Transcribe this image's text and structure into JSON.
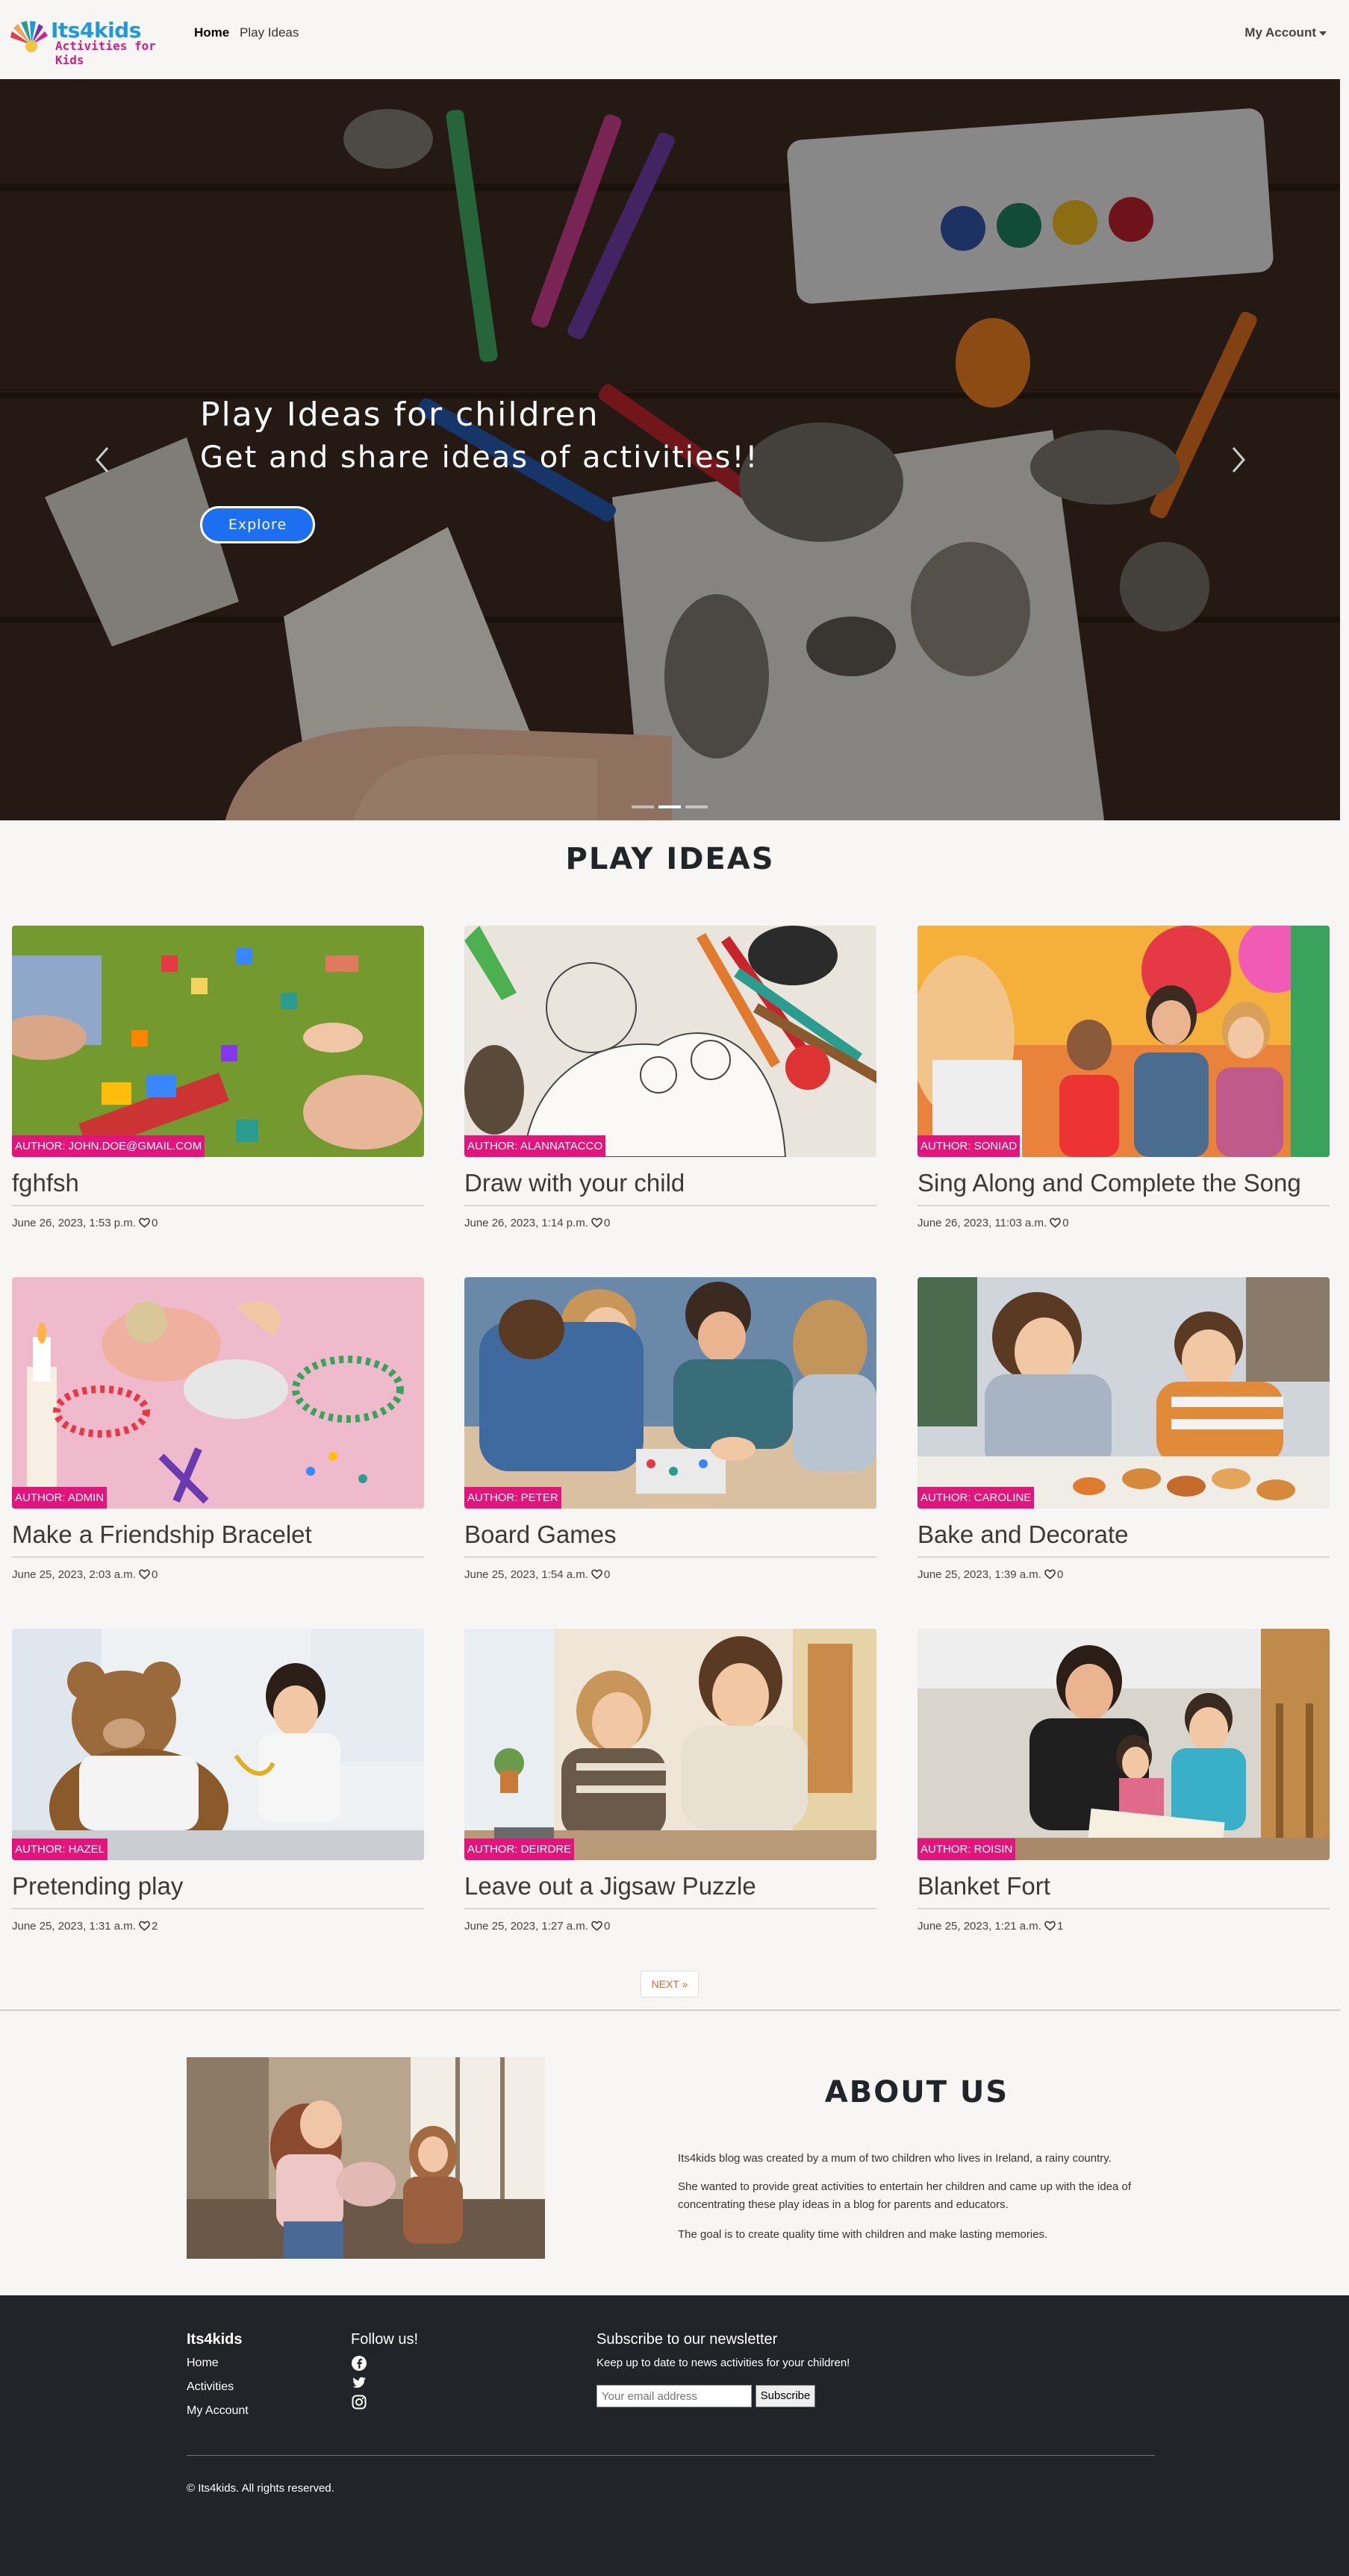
{
  "brand": {
    "name": "Its4kids",
    "tagline": "Activities for Kids"
  },
  "nav": {
    "home": "Home",
    "play_ideas": "Play Ideas",
    "account": "My Account"
  },
  "hero": {
    "caption_line1": "Play Ideas for children",
    "caption_line2": "Get and share ideas of activities!!",
    "button": "Explore",
    "slides": 3,
    "active_slide": 2
  },
  "play_ideas": {
    "heading": "PLAY IDEAS",
    "cards": [
      {
        "author": "AUTHOR: JOHN.DOE@GMAIL.COM",
        "title": "fghfsh",
        "date": "June 26, 2023, 1:53 p.m.",
        "likes": "0",
        "image": "toy-blocks-on-grass"
      },
      {
        "author": "AUTHOR: ALANNATACCO",
        "title": "Draw with your child",
        "date": "June 26, 2023, 1:14 p.m.",
        "likes": "0",
        "image": "coloring-page-pencils"
      },
      {
        "author": "AUTHOR: SONIAD",
        "title": "Sing Along and Complete the Song",
        "date": "June 26, 2023, 11:03 a.m.",
        "likes": "0",
        "image": "children-sitting"
      },
      {
        "author": "AUTHOR: ADMIN",
        "title": "Make a Friendship Bracelet",
        "date": "June 25, 2023, 2:03 a.m.",
        "likes": "0",
        "image": "beads-bracelets"
      },
      {
        "author": "AUTHOR: PETER",
        "title": "Board Games",
        "date": "June 25, 2023, 1:54 a.m.",
        "likes": "0",
        "image": "family-board-game"
      },
      {
        "author": "AUTHOR: CAROLINE",
        "title": "Bake and Decorate",
        "date": "June 25, 2023, 1:39 a.m.",
        "likes": "0",
        "image": "kids-decorating-cookies"
      },
      {
        "author": "AUTHOR: HAZEL",
        "title": "Pretending play",
        "date": "June 25, 2023, 1:31 a.m.",
        "likes": "2",
        "image": "teddy-bear-doctor"
      },
      {
        "author": "AUTHOR: DEIRDRE",
        "title": "Leave out a Jigsaw Puzzle",
        "date": "June 25, 2023, 1:27 a.m.",
        "likes": "0",
        "image": "mother-daughter-puzzle"
      },
      {
        "author": "AUTHOR: ROISIN",
        "title": "Blanket Fort",
        "date": "June 25, 2023, 1:21 a.m.",
        "likes": "1",
        "image": "father-kids-fort"
      }
    ],
    "next": "NEXT »"
  },
  "about": {
    "heading": "ABOUT US",
    "p1": "Its4kids blog was created by a mum of two children who lives in Ireland, a rainy country.",
    "p2": "She wanted to provide great activities to entertain her children and came up with the idea of concentrating these play ideas in a blog for parents and educators.",
    "p3": "The goal is to create quality time with children and make lasting memories."
  },
  "footer": {
    "brand": "Its4kids",
    "links": [
      "Home",
      "Activities",
      "My Account"
    ],
    "follow": "Follow us!",
    "social_icons": [
      "facebook-icon",
      "twitter-icon",
      "instagram-icon"
    ],
    "newsletter_title": "Subscribe to our newsletter",
    "newsletter_text": "Keep up to date to news activities for your children!",
    "email_placeholder": "Your email address",
    "subscribe": "Subscribe",
    "copyright": "© Its4kids. All rights reserved."
  },
  "colors": {
    "author_badge": "#e3157c",
    "explore_button": "#1d6ff2",
    "footer_bg": "#212529",
    "next_text": "#d9692b"
  }
}
